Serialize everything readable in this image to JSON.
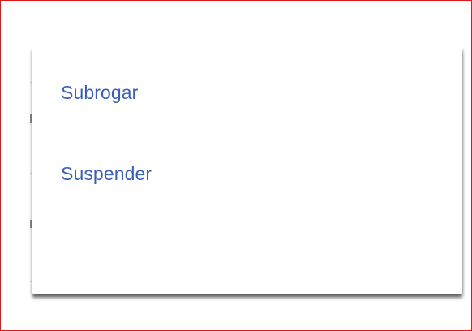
{
  "context_menu": {
    "items": [
      {
        "label": "Subrogar"
      },
      {
        "label": "Suspender"
      }
    ]
  },
  "colors": {
    "frame_border": "#e0161b",
    "menu_text": "#3b5fb8",
    "menu_background": "#ffffff"
  }
}
